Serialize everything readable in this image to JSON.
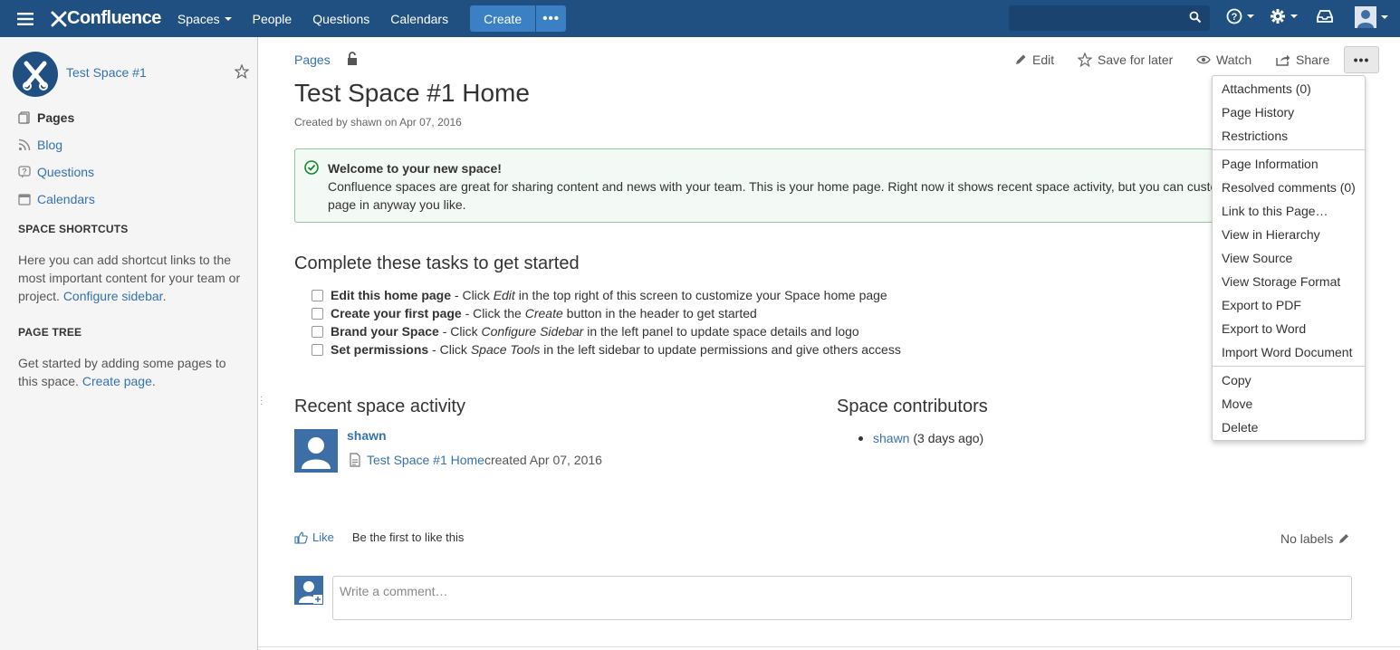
{
  "header": {
    "product_name": "Confluence",
    "nav": [
      "Spaces",
      "People",
      "Questions",
      "Calendars"
    ],
    "create_label": "Create",
    "more_label": "•••",
    "search_placeholder": ""
  },
  "sidebar": {
    "space_name": "Test Space #1",
    "items": [
      {
        "label": "Pages",
        "active": true
      },
      {
        "label": "Blog"
      },
      {
        "label": "Questions"
      },
      {
        "label": "Calendars"
      }
    ],
    "shortcuts_heading": "SPACE SHORTCUTS",
    "shortcuts_text": "Here you can add shortcut links to the most important content for your team or project.",
    "shortcuts_link": "Configure sidebar",
    "page_tree_heading": "PAGE TREE",
    "page_tree_text": "Get started by adding some pages to this space.",
    "page_tree_link": "Create page"
  },
  "page": {
    "breadcrumb": "Pages",
    "title": "Test Space #1 Home",
    "byline": "Created by shawn on Apr 07, 2016",
    "actions": {
      "edit": "Edit",
      "save_for_later": "Save for later",
      "watch": "Watch",
      "share": "Share",
      "more": "•••"
    },
    "welcome": {
      "title": "Welcome to your new space!",
      "body": "Confluence spaces are great for sharing content and news with your team. This is your home page. Right now it shows recent space activity, but you can customize this page in anyway you like."
    },
    "tasks_heading": "Complete these tasks to get started",
    "tasks": [
      {
        "bold": "Edit this home page",
        "pre": " - Click ",
        "em": "Edit",
        "post": " in the top right of this screen to customize your Space home page"
      },
      {
        "bold": "Create your first page",
        "pre": " - Click the ",
        "em": "Create",
        "post": " button in the header to get started"
      },
      {
        "bold": "Brand your Space",
        "pre": " - Click ",
        "em": "Configure Sidebar",
        "post": " in the left panel to update space details and logo"
      },
      {
        "bold": "Set permissions",
        "pre": " - Click ",
        "em": "Space Tools",
        "post": " in the left sidebar to update permissions and give others access"
      }
    ],
    "activity_heading": "Recent space activity",
    "activity": {
      "user": "shawn",
      "page_link": "Test Space #1 Home",
      "action": " created Apr 07, 2016"
    },
    "contributors_heading": "Space contributors",
    "contributor": {
      "name": "shawn",
      "when": "(3 days ago)"
    },
    "like_label": "Like",
    "like_text": "Be the first to like this",
    "labels_text": "No labels",
    "comment_placeholder": "Write a comment…"
  },
  "more_menu": {
    "groups": [
      [
        "Attachments (0)",
        "Page History",
        "Restrictions"
      ],
      [
        "Page Information",
        "Resolved comments (0)",
        "Link to this Page…",
        "View in Hierarchy",
        "View Source",
        "View Storage Format",
        "Export to PDF",
        "Export to Word",
        "Import Word Document"
      ],
      [
        "Copy",
        "Move",
        "Delete"
      ]
    ]
  },
  "colors": {
    "header_bg": "#205081",
    "create_button": "#3b7fc4",
    "link": "#3572b0",
    "success_border": "#91c89c"
  }
}
